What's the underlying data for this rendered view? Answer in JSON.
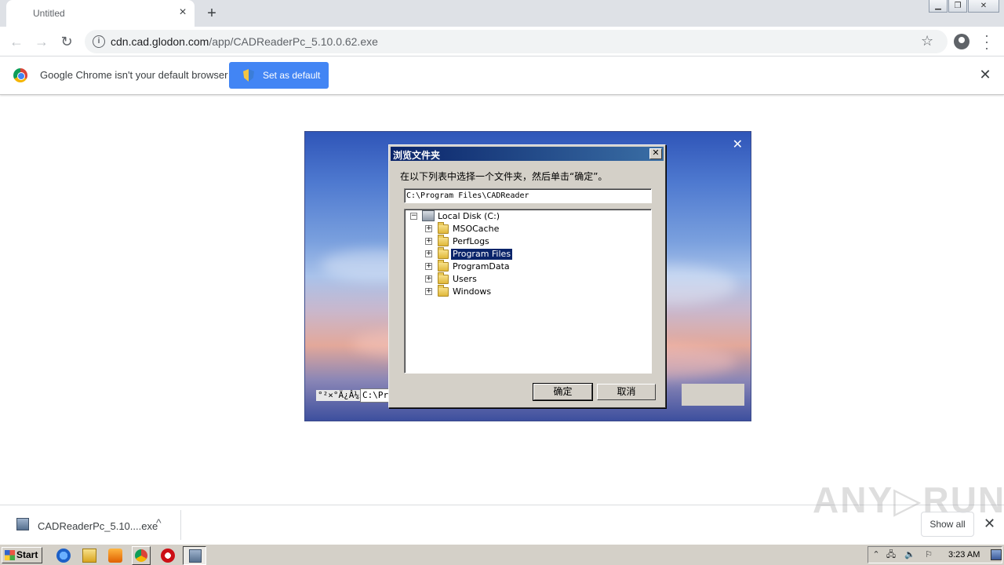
{
  "browser": {
    "tab_title": "Untitled",
    "tab_close": "×",
    "new_tab": "+",
    "url_host": "cdn.cad.glodon.com",
    "url_path": "/app/CADReaderPc_5.10.0.62.exe",
    "infobar_text": "Google Chrome isn't your default browser",
    "set_default_label": "Set as default",
    "infobar_close": "✕"
  },
  "installer": {
    "close": "✕",
    "garbled_label": "°²×°Ä¿Â¼£º",
    "path_value": "C:\\Pro"
  },
  "dialog": {
    "title": "浏览文件夹",
    "close": "✕",
    "prompt": "在以下列表中选择一个文件夹，然后单击“确定”。",
    "path_value": "C:\\Program Files\\CADReader",
    "tree": {
      "root_label": "Local Disk (C:)",
      "folders": [
        {
          "label": "MSOCache"
        },
        {
          "label": "PerfLogs"
        },
        {
          "label": "Program Files",
          "selected": true
        },
        {
          "label": "ProgramData"
        },
        {
          "label": "Users"
        },
        {
          "label": "Windows"
        }
      ]
    },
    "ok_label": "确定",
    "cancel_label": "取消"
  },
  "download_shelf": {
    "file_name": "CADReaderPc_5.10....exe",
    "chevron": "^",
    "show_all_label": "Show all",
    "close": "✕",
    "watermark": "ANY▷RUN"
  },
  "taskbar": {
    "start_label": "Start",
    "clock": "3:23 AM"
  }
}
